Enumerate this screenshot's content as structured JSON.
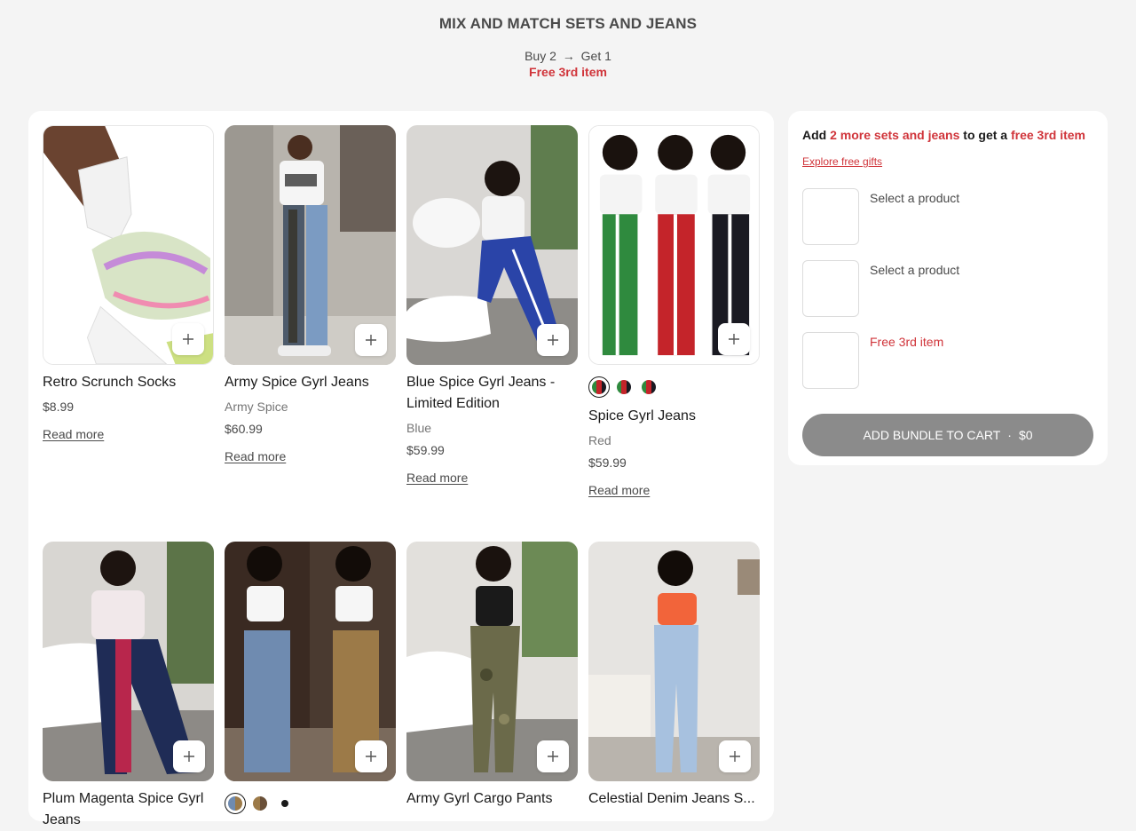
{
  "header": {
    "title": "MIX AND MATCH SETS AND JEANS",
    "offer_buy": "Buy 2",
    "offer_arrow": "→",
    "offer_get": "Get 1",
    "free_text": "Free 3rd item"
  },
  "products": [
    {
      "name": "Retro Scrunch Socks",
      "price": "$8.99",
      "read_more": "Read more"
    },
    {
      "name": "Army Spice Gyrl Jeans",
      "variant": "Army Spice",
      "price": "$60.99",
      "read_more": "Read more"
    },
    {
      "name": "Blue Spice Gyrl Jeans - Limited Edition",
      "variant": "Blue",
      "price": "$59.99",
      "read_more": "Read more"
    },
    {
      "name": "Spice Gyrl Jeans",
      "variant": "Red",
      "price": "$59.99",
      "read_more": "Read more"
    },
    {
      "name": "Plum Magenta Spice Gyrl Jeans"
    },
    {
      "name": ""
    },
    {
      "name": "Army Gyrl Cargo Pants"
    },
    {
      "name": "Celestial Denim Jeans S..."
    }
  ],
  "bundle": {
    "head_add": "Add",
    "head_count": "2 more sets and jeans",
    "head_mid": "to get a",
    "head_free": "free 3rd item",
    "explore": "Explore free gifts",
    "slots": [
      "Select a product",
      "Select a product",
      "Free 3rd item"
    ],
    "cart_label": "ADD BUNDLE TO CART",
    "cart_sep": "·",
    "cart_price": "$0"
  },
  "colors": {
    "accent_red": "#d0343a",
    "cart_button": "#8b8b8b"
  },
  "icons": {
    "add": "plus-icon",
    "arrow": "arrow-right-icon"
  }
}
